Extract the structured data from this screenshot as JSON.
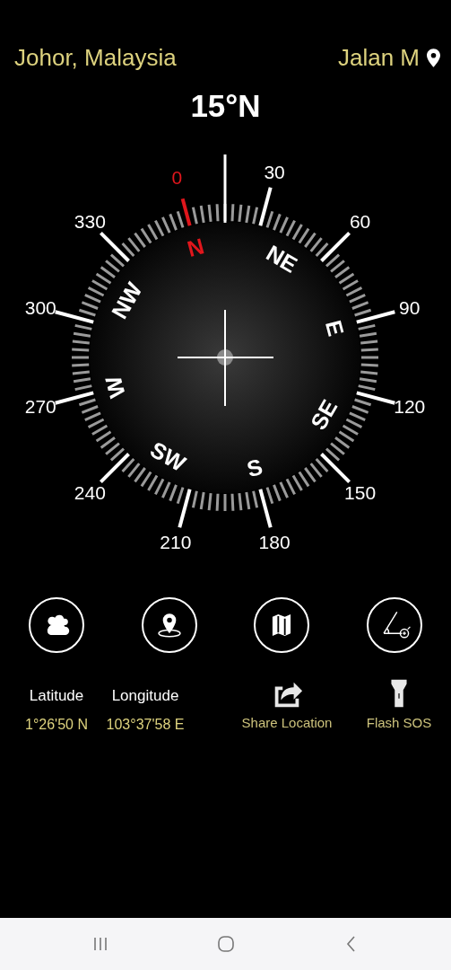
{
  "header": {
    "location": "Johor, Malaysia",
    "street": "Jalan M"
  },
  "heading": "15°N",
  "compass": {
    "degree_labels": [
      {
        "text": "0",
        "color": "#e0161c"
      },
      {
        "text": "30",
        "color": "#ffffff"
      },
      {
        "text": "60",
        "color": "#ffffff"
      },
      {
        "text": "90",
        "color": "#ffffff"
      },
      {
        "text": "120",
        "color": "#ffffff"
      },
      {
        "text": "150",
        "color": "#ffffff"
      },
      {
        "text": "180",
        "color": "#ffffff"
      },
      {
        "text": "210",
        "color": "#ffffff"
      },
      {
        "text": "240",
        "color": "#ffffff"
      },
      {
        "text": "270",
        "color": "#ffffff"
      },
      {
        "text": "300",
        "color": "#ffffff"
      },
      {
        "text": "330",
        "color": "#ffffff"
      }
    ],
    "directions": [
      {
        "text": "N",
        "color": "#e0161c"
      },
      {
        "text": "NE",
        "color": "#ffffff"
      },
      {
        "text": "E",
        "color": "#ffffff"
      },
      {
        "text": "SE",
        "color": "#ffffff"
      },
      {
        "text": "S",
        "color": "#ffffff"
      },
      {
        "text": "SW",
        "color": "#ffffff"
      },
      {
        "text": "W",
        "color": "#ffffff"
      },
      {
        "text": "NW",
        "color": "#ffffff"
      }
    ]
  },
  "tool_buttons": [
    {
      "kind": "weather"
    },
    {
      "kind": "location"
    },
    {
      "kind": "map"
    },
    {
      "kind": "angle"
    }
  ],
  "info": [
    {
      "kind": "coordinate",
      "label": "Latitude",
      "value": "1°26'50 N"
    },
    {
      "kind": "coordinate",
      "label": "Longitude",
      "value": "103°37'58 E"
    },
    {
      "kind": "share",
      "label": "Share Location"
    },
    {
      "kind": "flash",
      "label": "Flash SOS"
    }
  ],
  "nav_bar": [
    {
      "kind": "recent"
    },
    {
      "kind": "home"
    },
    {
      "kind": "back"
    }
  ]
}
